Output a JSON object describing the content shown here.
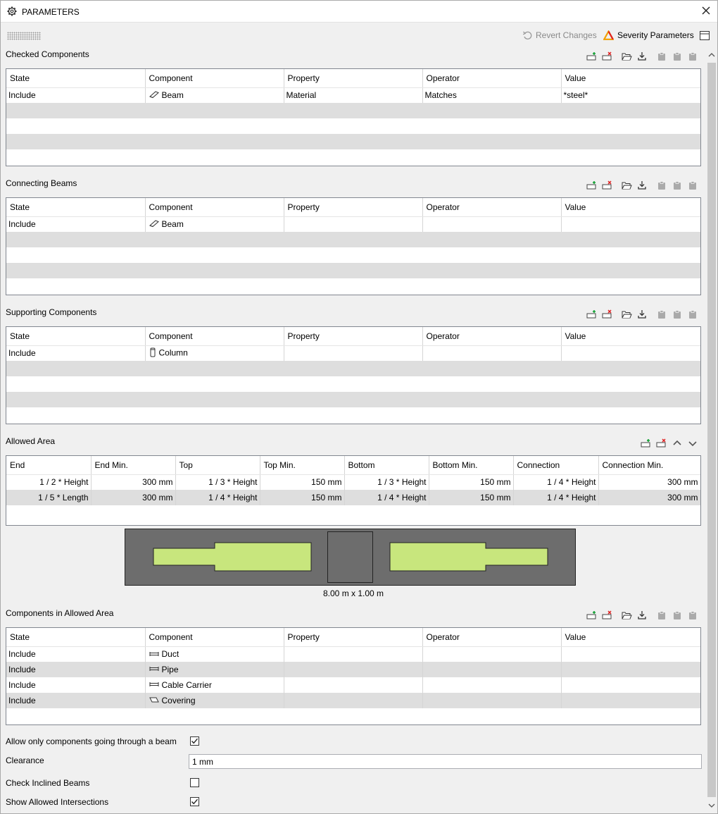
{
  "window": {
    "title": "PARAMETERS"
  },
  "topbar": {
    "revert_label": "Revert Changes",
    "severity_label": "Severity Parameters"
  },
  "sections": {
    "checked": {
      "title": "Checked Components",
      "columns": [
        "State",
        "Component",
        "Property",
        "Operator",
        "Value"
      ],
      "rows": [
        {
          "state": "Include",
          "icon": "beam-icon",
          "component": "Beam",
          "property": "Material",
          "operator": "Matches",
          "value": "*steel*"
        }
      ]
    },
    "connecting": {
      "title": "Connecting Beams",
      "columns": [
        "State",
        "Component",
        "Property",
        "Operator",
        "Value"
      ],
      "rows": [
        {
          "state": "Include",
          "icon": "beam-icon",
          "component": "Beam",
          "property": "",
          "operator": "",
          "value": ""
        }
      ]
    },
    "supporting": {
      "title": "Supporting Components",
      "columns": [
        "State",
        "Component",
        "Property",
        "Operator",
        "Value"
      ],
      "rows": [
        {
          "state": "Include",
          "icon": "column-icon",
          "component": "Column",
          "property": "",
          "operator": "",
          "value": ""
        }
      ]
    },
    "allowed_area": {
      "title": "Allowed Area",
      "columns": [
        "End",
        "End Min.",
        "Top",
        "Top Min.",
        "Bottom",
        "Bottom Min.",
        "Connection",
        "Connection Min."
      ],
      "rows": [
        [
          "1 / 2 * Height",
          "300 mm",
          "1 / 3 * Height",
          "150 mm",
          "1 / 3 * Height",
          "150 mm",
          "1 / 4 * Height",
          "300 mm"
        ],
        [
          "1 / 5 * Length",
          "300 mm",
          "1 / 4 * Height",
          "150 mm",
          "1 / 4 * Height",
          "150 mm",
          "1 / 4 * Height",
          "300 mm"
        ]
      ],
      "diagram_caption": "8.00 m x 1.00 m",
      "colors": {
        "beam_fill": "#6d6d6d",
        "allowed_fill": "#c8e67d"
      }
    },
    "components_in_area": {
      "title": "Components in Allowed Area",
      "columns": [
        "State",
        "Component",
        "Property",
        "Operator",
        "Value"
      ],
      "rows": [
        {
          "state": "Include",
          "icon": "duct-icon",
          "component": "Duct",
          "property": "",
          "operator": "",
          "value": ""
        },
        {
          "state": "Include",
          "icon": "pipe-icon",
          "component": "Pipe",
          "property": "",
          "operator": "",
          "value": ""
        },
        {
          "state": "Include",
          "icon": "cable-carrier-icon",
          "component": "Cable Carrier",
          "property": "",
          "operator": "",
          "value": ""
        },
        {
          "state": "Include",
          "icon": "covering-icon",
          "component": "Covering",
          "property": "",
          "operator": "",
          "value": ""
        }
      ]
    }
  },
  "options": {
    "allow_through_beam": {
      "label": "Allow only components going through a beam",
      "checked": true
    },
    "clearance": {
      "label": "Clearance",
      "value": "1 mm"
    },
    "check_inclined": {
      "label": "Check Inclined Beams",
      "checked": false
    },
    "show_intersections": {
      "label": "Show Allowed Intersections",
      "checked": true
    }
  }
}
